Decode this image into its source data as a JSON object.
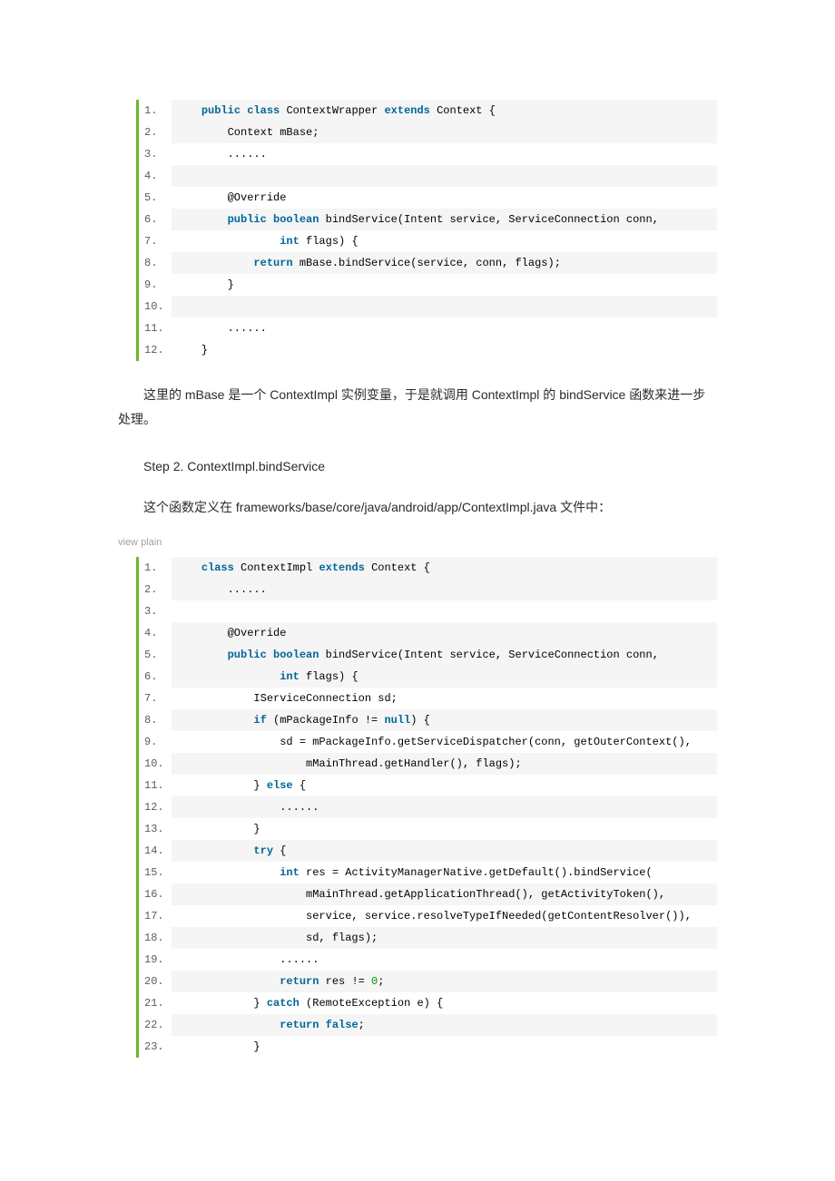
{
  "block1": {
    "lines": [
      {
        "n": "1.",
        "hl": true,
        "tokens": [
          [
            "    ",
            ""
          ],
          [
            "public",
            "kw"
          ],
          [
            " ",
            ""
          ],
          [
            "class",
            "kw"
          ],
          [
            " ContextWrapper ",
            ""
          ],
          [
            "extends",
            "kw"
          ],
          [
            " Context {  ",
            ""
          ]
        ]
      },
      {
        "n": "2.",
        "hl": true,
        "tokens": [
          [
            "        Context mBase;  ",
            ""
          ]
        ]
      },
      {
        "n": "3.",
        "hl": false,
        "tokens": [
          [
            "        ......  ",
            ""
          ]
        ]
      },
      {
        "n": "4.",
        "hl": true,
        "tokens": [
          [
            "      ",
            ""
          ]
        ]
      },
      {
        "n": "5.",
        "hl": false,
        "tokens": [
          [
            "        ",
            ""
          ],
          [
            "@Override",
            ""
          ],
          [
            "  ",
            ""
          ]
        ]
      },
      {
        "n": "6.",
        "hl": true,
        "tokens": [
          [
            "        ",
            ""
          ],
          [
            "public",
            "kw"
          ],
          [
            " ",
            ""
          ],
          [
            "boolean",
            "kw"
          ],
          [
            " bindService(Intent service, ServiceConnection conn,  ",
            ""
          ]
        ]
      },
      {
        "n": "7.",
        "hl": false,
        "tokens": [
          [
            "                ",
            ""
          ],
          [
            "int",
            "kw"
          ],
          [
            " flags) {  ",
            ""
          ]
        ]
      },
      {
        "n": "8.",
        "hl": true,
        "tokens": [
          [
            "            ",
            ""
          ],
          [
            "return",
            "kw"
          ],
          [
            " mBase.bindService(service, conn, flags);  ",
            ""
          ]
        ]
      },
      {
        "n": "9.",
        "hl": false,
        "tokens": [
          [
            "        }  ",
            ""
          ]
        ]
      },
      {
        "n": "10.",
        "hl": true,
        "tokens": [
          [
            "      ",
            ""
          ]
        ]
      },
      {
        "n": "11.",
        "hl": false,
        "tokens": [
          [
            "        ......  ",
            ""
          ]
        ]
      },
      {
        "n": "12.",
        "hl": false,
        "tokens": [
          [
            "    }  ",
            ""
          ]
        ]
      }
    ]
  },
  "para1": "这里的 mBase 是一个 ContextImpl 实例变量，于是就调用 ContextImpl 的 bindService 函数来进一步处理。",
  "stepHeading": "Step 2. ContextImpl.bindService",
  "para2": "这个函数定义在 frameworks/base/core/java/android/app/ContextImpl.java 文件中：",
  "viewplain": {
    "view": "view",
    "plain": "plain"
  },
  "block2": {
    "lines": [
      {
        "n": "1.",
        "hl": true,
        "tokens": [
          [
            "    ",
            ""
          ],
          [
            "class",
            "kw"
          ],
          [
            " ContextImpl ",
            ""
          ],
          [
            "extends",
            "kw"
          ],
          [
            " Context {  ",
            ""
          ]
        ]
      },
      {
        "n": "2.",
        "hl": true,
        "tokens": [
          [
            "        ......  ",
            ""
          ]
        ]
      },
      {
        "n": "3.",
        "hl": false,
        "tokens": [
          [
            "      ",
            ""
          ]
        ]
      },
      {
        "n": "4.",
        "hl": true,
        "tokens": [
          [
            "        ",
            ""
          ],
          [
            "@Override",
            ""
          ],
          [
            "  ",
            ""
          ]
        ]
      },
      {
        "n": "5.",
        "hl": true,
        "tokens": [
          [
            "        ",
            ""
          ],
          [
            "public",
            "kw"
          ],
          [
            " ",
            ""
          ],
          [
            "boolean",
            "kw"
          ],
          [
            " bindService(Intent service, ServiceConnection conn,  ",
            ""
          ]
        ]
      },
      {
        "n": "6.",
        "hl": true,
        "tokens": [
          [
            "                ",
            ""
          ],
          [
            "int",
            "kw"
          ],
          [
            " flags) {  ",
            ""
          ]
        ]
      },
      {
        "n": "7.",
        "hl": false,
        "tokens": [
          [
            "            IServiceConnection sd;  ",
            ""
          ]
        ]
      },
      {
        "n": "8.",
        "hl": true,
        "tokens": [
          [
            "            ",
            ""
          ],
          [
            "if",
            "kw"
          ],
          [
            " (mPackageInfo != ",
            ""
          ],
          [
            "null",
            "kw"
          ],
          [
            ") {  ",
            ""
          ]
        ]
      },
      {
        "n": "9.",
        "hl": false,
        "tokens": [
          [
            "                sd = mPackageInfo.getServiceDispatcher(conn, getOuterContext(),  ",
            ""
          ]
        ]
      },
      {
        "n": "10.",
        "hl": true,
        "tokens": [
          [
            "                    mMainThread.getHandler(), flags);  ",
            ""
          ]
        ]
      },
      {
        "n": "11.",
        "hl": false,
        "tokens": [
          [
            "            } ",
            ""
          ],
          [
            "else",
            "kw"
          ],
          [
            " {  ",
            ""
          ]
        ]
      },
      {
        "n": "12.",
        "hl": true,
        "tokens": [
          [
            "                ......  ",
            ""
          ]
        ]
      },
      {
        "n": "13.",
        "hl": false,
        "tokens": [
          [
            "            }  ",
            ""
          ]
        ]
      },
      {
        "n": "14.",
        "hl": true,
        "tokens": [
          [
            "            ",
            ""
          ],
          [
            "try",
            "kw"
          ],
          [
            " {  ",
            ""
          ]
        ]
      },
      {
        "n": "15.",
        "hl": false,
        "tokens": [
          [
            "                ",
            ""
          ],
          [
            "int",
            "kw"
          ],
          [
            " res = ActivityManagerNative.getDefault().bindService(  ",
            ""
          ]
        ]
      },
      {
        "n": "16.",
        "hl": true,
        "tokens": [
          [
            "                    mMainThread.getApplicationThread(), getActivityToken(),  ",
            ""
          ]
        ]
      },
      {
        "n": "17.",
        "hl": false,
        "tokens": [
          [
            "                    service, service.resolveTypeIfNeeded(getContentResolver()),  ",
            ""
          ]
        ]
      },
      {
        "n": "18.",
        "hl": true,
        "tokens": [
          [
            "                    sd, flags);  ",
            ""
          ]
        ]
      },
      {
        "n": "19.",
        "hl": false,
        "tokens": [
          [
            "                ......  ",
            ""
          ]
        ]
      },
      {
        "n": "20.",
        "hl": true,
        "tokens": [
          [
            "                ",
            ""
          ],
          [
            "return",
            "kw"
          ],
          [
            " res != ",
            ""
          ],
          [
            "0",
            "num"
          ],
          [
            ";  ",
            ""
          ]
        ]
      },
      {
        "n": "21.",
        "hl": false,
        "tokens": [
          [
            "            } ",
            ""
          ],
          [
            "catch",
            "kw"
          ],
          [
            " (RemoteException e) {  ",
            ""
          ]
        ]
      },
      {
        "n": "22.",
        "hl": true,
        "tokens": [
          [
            "                ",
            ""
          ],
          [
            "return",
            "kw"
          ],
          [
            " ",
            ""
          ],
          [
            "false",
            "kw"
          ],
          [
            ";  ",
            ""
          ]
        ]
      },
      {
        "n": "23.",
        "hl": false,
        "tokens": [
          [
            "            }  ",
            ""
          ]
        ]
      }
    ]
  }
}
